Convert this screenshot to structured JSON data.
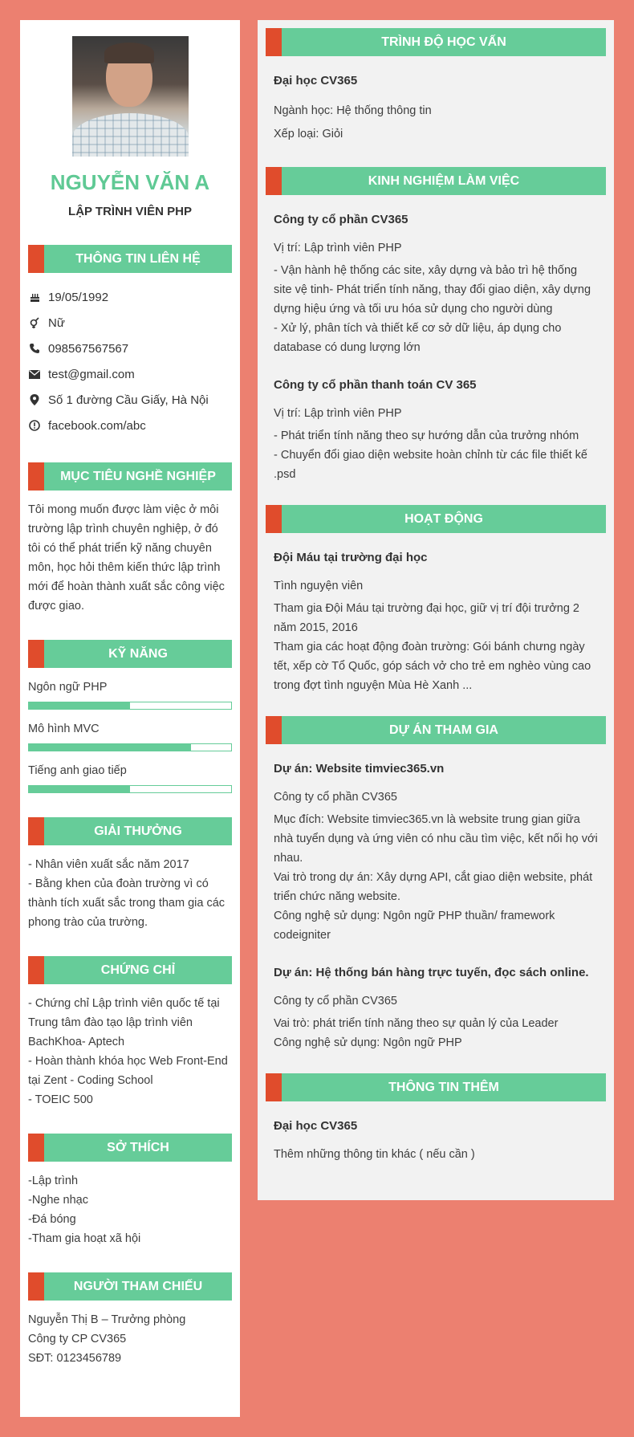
{
  "profile": {
    "name": "NGUYỄN VĂN A",
    "job_title": "LẬP TRÌNH VIÊN PHP"
  },
  "contact": {
    "heading": "THÔNG TIN LIÊN HỆ",
    "items": [
      {
        "icon": "birthday-cake-icon",
        "value": "19/05/1992"
      },
      {
        "icon": "gender-icon",
        "value": "Nữ"
      },
      {
        "icon": "phone-icon",
        "value": "098567567567"
      },
      {
        "icon": "email-icon",
        "value": "test@gmail.com"
      },
      {
        "icon": "location-pin-icon",
        "value": "Số 1 đường Cầu Giấy, Hà Nội"
      },
      {
        "icon": "info-icon",
        "value": "facebook.com/abc"
      }
    ]
  },
  "objective": {
    "heading": "MỤC TIÊU NGHỀ NGHIỆP",
    "text": "Tôi mong muốn được làm việc ở môi trường lập trình chuyên nghiệp, ở đó tôi có thể phát triển kỹ năng chuyên môn, học hỏi thêm kiến thức lập trình mới để hoàn thành xuất sắc công việc được giao."
  },
  "skills": {
    "heading": "KỸ NĂNG",
    "items": [
      {
        "name": "Ngôn ngữ PHP",
        "level": 0.5
      },
      {
        "name": "Mô hình MVC",
        "level": 0.8
      },
      {
        "name": "Tiếng anh giao tiếp",
        "level": 0.5
      }
    ]
  },
  "awards": {
    "heading": "GIẢI THƯỞNG",
    "text": "- Nhân viên xuất sắc năm 2017\n- Bằng khen của đoàn trường vì có thành tích xuất sắc trong tham gia các phong trào của trường."
  },
  "certificates": {
    "heading": "CHỨNG CHỈ",
    "text": "- Chứng chỉ Lập trình viên quốc tế tại Trung tâm đào tạo lập trình viên BachKhoa- Aptech\n- Hoàn thành khóa học Web Front-End tại Zent - Coding School\n- TOEIC 500"
  },
  "hobbies": {
    "heading": "SỞ THÍCH",
    "text": "-Lập trình\n-Nghe nhạc\n-Đá bóng\n-Tham gia hoạt xã hội"
  },
  "references": {
    "heading": "NGƯỜI THAM CHIẾU",
    "text": "Nguyễn Thị B  – Trưởng phòng\nCông ty CP CV365\nSĐT: 0123456789"
  },
  "education": {
    "heading": "TRÌNH ĐỘ HỌC VẤN",
    "title": "Đại học CV365",
    "lines": "Ngành học: Hệ thống thông tin\nXếp loại: Giỏi"
  },
  "experience": {
    "heading": "KINH NGHIỆM LÀM VIỆC",
    "items": [
      {
        "company": "Công ty cổ phần CV365",
        "position": "Vị trí: Lập trình viên PHP",
        "description": "- Vận hành hệ thống các site, xây dựng và bảo trì hệ thống site vệ tinh- Phát triển tính năng, thay đổi giao diện, xây dựng dựng hiệu ứng và tối ưu hóa sử dụng cho người dùng\n- Xử lý, phân tích và thiết kế cơ sở dữ liệu, áp dụng cho database có dung lượng lớn"
      },
      {
        "company": "Công ty cổ phần thanh toán CV 365",
        "position": "Vị trí: Lập trình viên PHP",
        "description": "- Phát triển tính năng theo sự hướng dẫn của trưởng nhóm\n- Chuyển đổi giao diện website hoàn chỉnh từ các file thiết kế .psd"
      }
    ]
  },
  "activities": {
    "heading": "HOẠT ĐỘNG",
    "title": "Đội Máu tại trường đại học",
    "role": "Tình nguyện viên",
    "description": "Tham gia Đội Máu tại trường đại học, giữ vị trí đội trưởng 2 năm 2015, 2016\nTham gia các hoạt động đoàn trường: Gói bánh chưng ngày tết, xếp cờ Tổ Quốc, góp sách vở cho trẻ em nghèo vùng cao trong đợt tình nguyện Mùa Hè Xanh ..."
  },
  "projects": {
    "heading": "DỰ ÁN THAM GIA",
    "items": [
      {
        "title": "Dự án: Website timviec365.vn",
        "company": "Công ty cổ phần CV365",
        "description": "Mục đích: Website timviec365.vn là website trung gian giữa nhà tuyển dụng và ứng viên có nhu cầu tìm việc, kết nối họ với nhau.\nVai trò trong dự án: Xây dựng API, cắt giao diện website, phát triển chức năng website.\nCông nghệ sử dụng: Ngôn ngữ PHP thuần/ framework codeigniter"
      },
      {
        "title": "Dự án: Hệ thống bán hàng trực tuyến, đọc sách online.",
        "company": "Công ty cổ phần CV365",
        "description": "Vai trò: phát triển tính năng theo sự quản lý của Leader\nCông nghệ sử dụng: Ngôn ngữ PHP"
      }
    ]
  },
  "extra": {
    "heading": "THÔNG TIN THÊM",
    "title": "Đại học CV365",
    "text": "Thêm những thông tin khác ( nếu cần )"
  },
  "colors": {
    "background": "#ec8070",
    "accent_green": "#66cc99",
    "accent_red": "#e04c2c",
    "name_green": "#5fc994"
  }
}
